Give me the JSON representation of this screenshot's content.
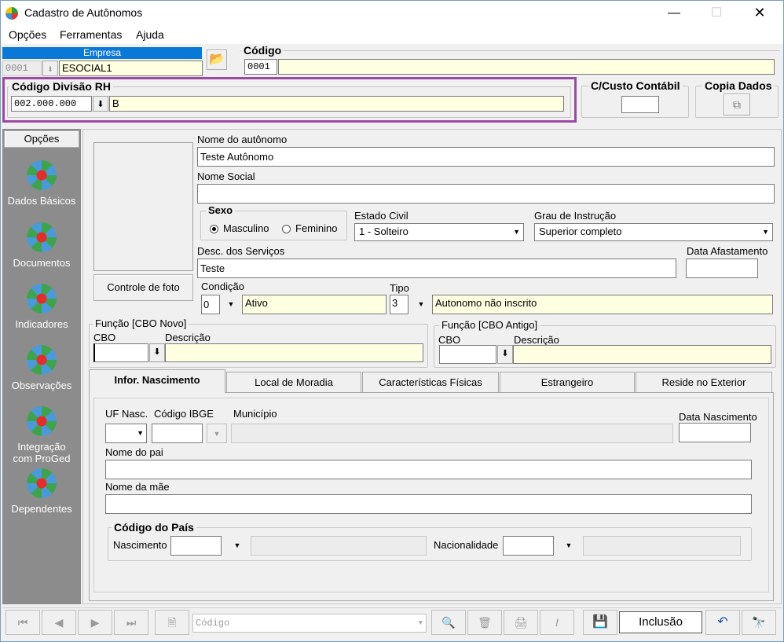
{
  "window": {
    "title": "Cadastro de Autônomos"
  },
  "menu": {
    "opcoes": "Opções",
    "ferramentas": "Ferramentas",
    "ajuda": "Ajuda"
  },
  "empresa": {
    "header": "Empresa",
    "code": "0001",
    "name": "ESOCIAL1"
  },
  "codigo": {
    "title": "Código",
    "value": "0001"
  },
  "divisao": {
    "title": "Código Divisão RH",
    "code": "002.000.000",
    "desc": "B"
  },
  "ccusto": {
    "title": "C/Custo Contábil"
  },
  "copia": {
    "title": "Copia Dados"
  },
  "sidebar": {
    "header": "Opções",
    "items": [
      {
        "label": "Dados Básicos"
      },
      {
        "label": "Documentos"
      },
      {
        "label": "Indicadores"
      },
      {
        "label": "Observações"
      },
      {
        "label": "Integração com ProGed"
      },
      {
        "label": "Dependentes"
      }
    ]
  },
  "photo": {
    "button": "Controle de foto"
  },
  "form": {
    "nome_label": "Nome do autônomo",
    "nome_value": "Teste Autônomo",
    "social_label": "Nome Social",
    "social_value": "",
    "sexo_title": "Sexo",
    "sexo_masc": "Masculino",
    "sexo_fem": "Feminino",
    "estado_civil_label": "Estado Civil",
    "estado_civil_value": "1 - Solteiro",
    "grau_label": "Grau de Instrução",
    "grau_value": "Superior completo",
    "desc_label": "Desc. dos Serviços",
    "desc_value": "Teste",
    "afast_label": "Data Afastamento",
    "cond_label": "Condição",
    "cond_code": "0",
    "cond_desc": "Ativo",
    "tipo_label": "Tipo",
    "tipo_code": "3",
    "tipo_desc": "Autonomo não inscrito"
  },
  "cbo_novo": {
    "title": "Função [CBO Novo]",
    "cbo": "CBO",
    "desc": "Descrição"
  },
  "cbo_antigo": {
    "title": "Função [CBO Antigo]",
    "cbo": "CBO",
    "desc": "Descrição"
  },
  "tabs": [
    "Infor. Nascimento",
    "Local de Moradia",
    "Características Físicas",
    "Estrangeiro",
    "Reside no Exterior"
  ],
  "nascimento": {
    "uf_label": "UF Nasc.",
    "ibge_label": "Código IBGE",
    "municipio_label": "Município",
    "data_label": "Data Nascimento",
    "pai_label": "Nome do pai",
    "mae_label": "Nome da mãe",
    "pais_title": "Código do País",
    "nasc_label": "Nascimento",
    "nacionalidade_label": "Nacionalidade"
  },
  "bottom": {
    "search_placeholder": "Código",
    "status": "Inclusão"
  }
}
